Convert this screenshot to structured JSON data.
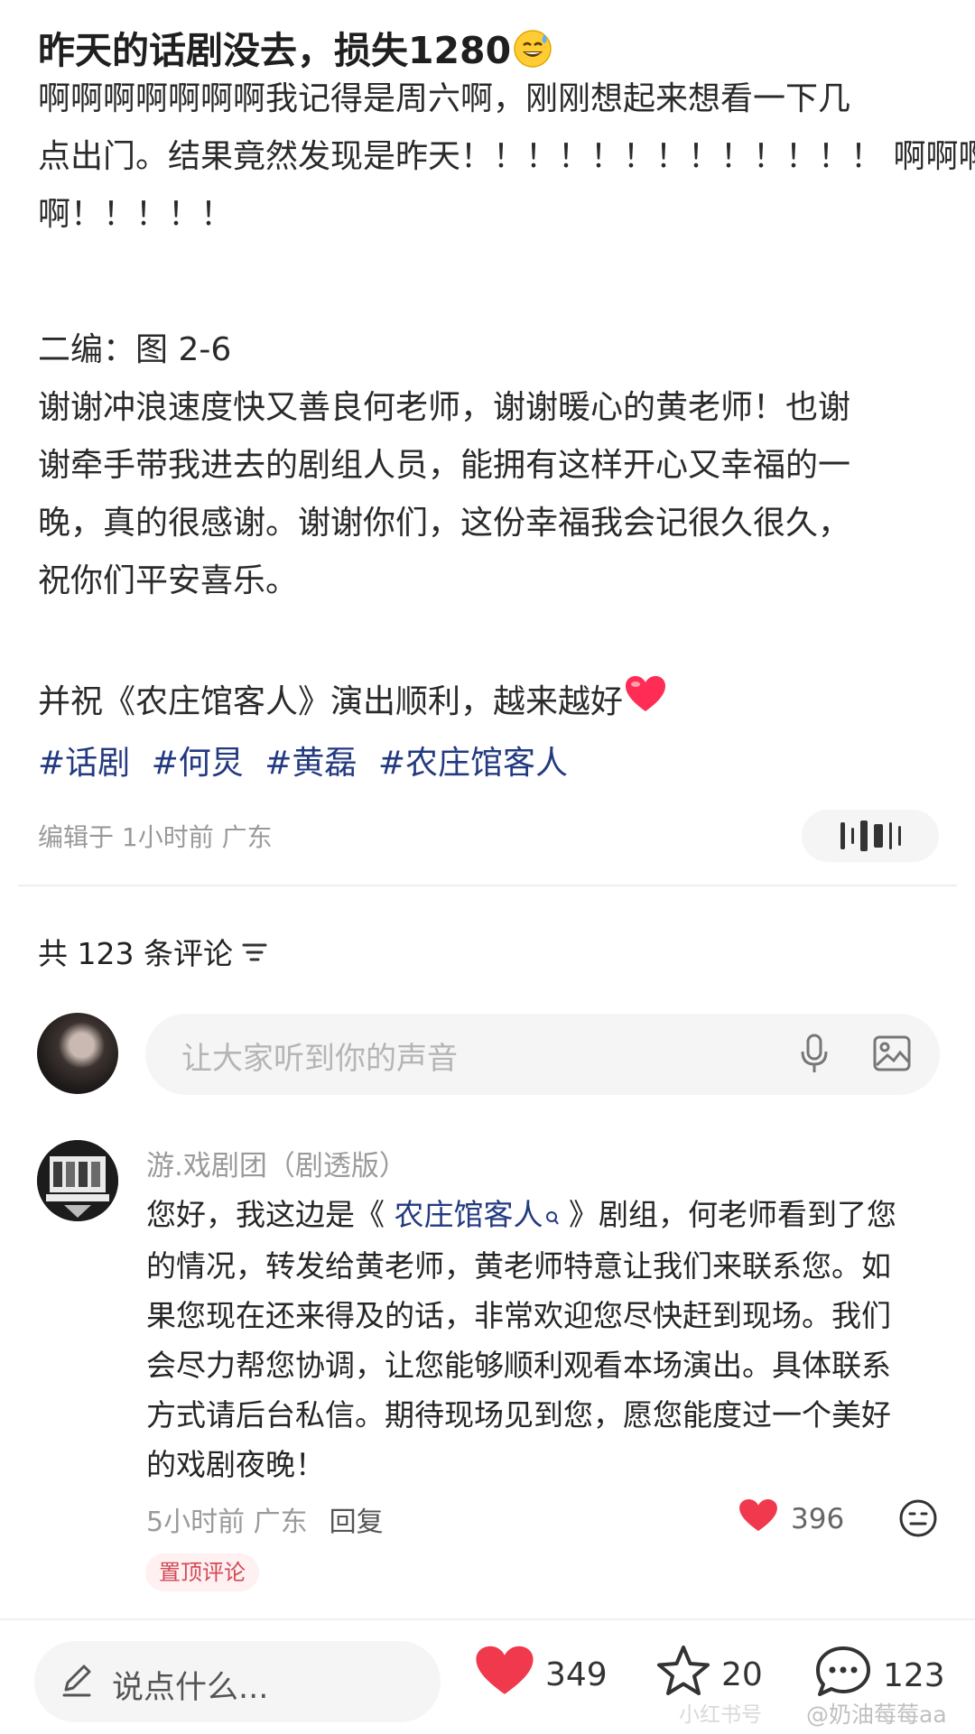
{
  "post": {
    "title": "昨天的话剧没去，损失1280",
    "paragraph1": [
      "啊啊啊啊啊啊啊我记得是周六啊，刚刚想起来想看一下几",
      "点出门。结果竟然发现是昨天！！！！！！！！！！！！！ 啊啊啊",
      "啊！！！！！"
    ],
    "edit_note": "二编：图 2-6",
    "paragraph2": [
      "谢谢冲浪速度快又善良何老师，谢谢暖心的黄老师！也谢",
      "谢牵手带我进去的剧组人员，能拥有这样开心又幸福的一",
      "晚，真的很感谢。谢谢你们，这份幸福我会记很久很久，",
      "祝你们平安喜乐。"
    ],
    "wish": "并祝《农庄馆客人》演出顺利，越来越好",
    "hashtags": [
      "#话剧",
      "#何炅",
      "#黄磊",
      "#农庄馆客人"
    ],
    "edited": "编辑于 1小时前 广东"
  },
  "comments_header": {
    "count_text": "共 123 条评论"
  },
  "comment_input": {
    "placeholder": "让大家听到你的声音"
  },
  "comment": {
    "author": "游.戏剧团（剧透版）",
    "line1_before": "您好，我这边是《 ",
    "line1_link": "农庄馆客人",
    "line1_after": " 》剧组，何老师看到了您",
    "lines": [
      "的情况，转发给黄老师，黄老师特意让我们来联系您。如",
      "果您现在还来得及的话，非常欢迎您尽快赶到现场。我们",
      "会尽力帮您协调，让您能够顺利观看本场演出。具体联系",
      "方式请后台私信。期待现场见到您，愿您能度过一个美好",
      "的戏剧夜晚！"
    ],
    "time_loc": "5小时前 广东",
    "reply_label": "回复",
    "likes": "396",
    "pinned_label": "置顶评论"
  },
  "bottom_bar": {
    "input_placeholder": "说点什么...",
    "likes": "349",
    "stars": "20",
    "comments": "123"
  },
  "watermark": {
    "text1": "小红书号",
    "text2": "@奶油莓莓aa"
  },
  "colors": {
    "accent_red": "#f0394d",
    "hashtag_blue": "#233a80"
  }
}
